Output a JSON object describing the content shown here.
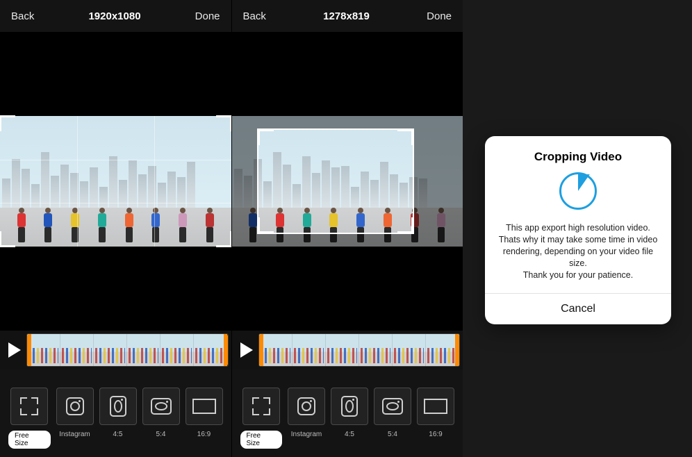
{
  "panels": [
    {
      "back": "Back",
      "dims": "1920x1080",
      "done": "Done",
      "crop_mode": "full",
      "presets": [
        {
          "id": "free",
          "label": "Free Size",
          "selected": true,
          "icon": "free"
        },
        {
          "id": "ig",
          "label": "Instagram",
          "icon": "ig"
        },
        {
          "id": "r45",
          "label": "4:5",
          "icon": "ig-tall"
        },
        {
          "id": "r54",
          "label": "5:4",
          "icon": "ig-wide"
        },
        {
          "id": "r169",
          "label": "16:9",
          "icon": "rect"
        }
      ]
    },
    {
      "back": "Back",
      "dims": "1278x819",
      "done": "Done",
      "crop_mode": "inset",
      "presets": [
        {
          "id": "free",
          "label": "Free Size",
          "selected": true,
          "icon": "free"
        },
        {
          "id": "ig",
          "label": "Instagram",
          "icon": "ig"
        },
        {
          "id": "r45",
          "label": "4:5",
          "icon": "ig-tall"
        },
        {
          "id": "r54",
          "label": "5:4",
          "icon": "ig-wide"
        },
        {
          "id": "r169",
          "label": "16:9",
          "icon": "rect"
        }
      ]
    }
  ],
  "modal": {
    "title": "Cropping Video",
    "line1": "This app export high resolution video.",
    "line2": "Thats why it may take some time in video rendering, depending on your video file size.",
    "line3": "Thank you for your patience.",
    "cancel": "Cancel"
  }
}
